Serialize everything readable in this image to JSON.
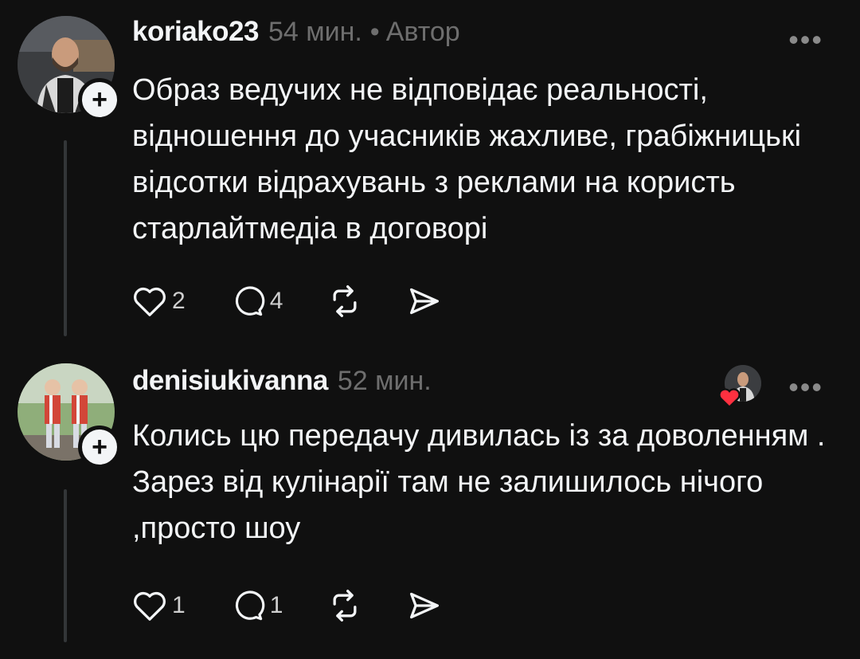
{
  "posts": [
    {
      "username": "koriako23",
      "time": "54 мин.",
      "separator": "•",
      "role": "Автор",
      "text": "Образ ведучих не відповідає реальності, відношення до учасників жахливе, грабіжницькі відсотки відрахувань з реклами на користь старлайтмедіа в договорі",
      "likes": "2",
      "replies": "4",
      "more_label": "•••"
    },
    {
      "username": "denisiukivanna",
      "time": "52 мин.",
      "text": "Колись цю передачу дивилась із за доволенням . Зарез від кулінарії там не залишилось нічого ,просто шоу",
      "likes": "1",
      "replies": "1",
      "more_label": "•••"
    }
  ],
  "icons": {
    "like": "heart-icon",
    "reply": "comment-icon",
    "repost": "repost-icon",
    "share": "send-icon",
    "follow": "plus-icon"
  },
  "colors": {
    "background": "#101010",
    "text": "#f3f5f7",
    "muted": "#6e6e6e",
    "heart": "#ff3040"
  }
}
